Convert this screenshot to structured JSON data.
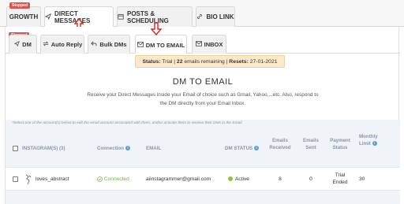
{
  "top_tabs": [
    {
      "label": "GROWTH",
      "icon": "stopped-badge",
      "badge": "Stopped"
    },
    {
      "label": "DIRECT MESSAGES",
      "icon": "paper-plane-icon"
    },
    {
      "label": "POSTS & SCHEDULING",
      "icon": "calendar-icon"
    },
    {
      "label": "BIO LINK",
      "icon": "link-icon"
    }
  ],
  "sub_tabs": [
    {
      "label": "DM",
      "icon": "paper-plane-icon",
      "badge": "Stopped"
    },
    {
      "label": "Auto Reply",
      "icon": "exchange-icon"
    },
    {
      "label": "Bulk DMs",
      "icon": "reply-icon"
    },
    {
      "label": "DM TO EMAIL",
      "icon": "envelope-icon"
    },
    {
      "label": "INBOX",
      "icon": "inbox-icon"
    }
  ],
  "status_bar": {
    "status_label": "Status:",
    "status_value": "Trial",
    "emails_count": "22",
    "emails_text": "emails remaining",
    "resets_label": "Resets:",
    "resets_value": "27-01-2021"
  },
  "main": {
    "title": "DM TO EMAIL",
    "description_line1": "Receive your Direct Messages inside your Email of choice such as Gmail, Yahoo,...etc. Also, respond to",
    "description_line2": "the DM directly from your Email Inbox.",
    "note": "*Select one of the account(s) below to edit the email account associated with them, and/or activate them to receive their DMs in the Email."
  },
  "table": {
    "headers": {
      "instagram": "INSTAGRAM(S) (3)",
      "connection": "Connection",
      "email": "EMAIL",
      "dm_status": "DM STATUS",
      "emails_received": [
        "Emails",
        "Received"
      ],
      "emails_sent": [
        "Emails",
        "Sent"
      ],
      "payment_status": [
        "Payment",
        "Status"
      ],
      "monthly_limit": [
        "Monthly",
        "Limit"
      ]
    },
    "rows": [
      {
        "account": "loves_abstract",
        "connection": "Connected",
        "email": "aiinstagrammer@gmail.com",
        "dm_status": "Active",
        "emails_received": "8",
        "emails_sent": "0",
        "payment_status": [
          "Trial",
          "Ended"
        ],
        "monthly_limit": "30"
      }
    ]
  },
  "colors": {
    "accent_red": "#d9251d",
    "badge_red": "#d9534f",
    "connected_green": "#6ab43e",
    "status_bg": "#fbe9cc",
    "header_text": "#8a96a8"
  }
}
